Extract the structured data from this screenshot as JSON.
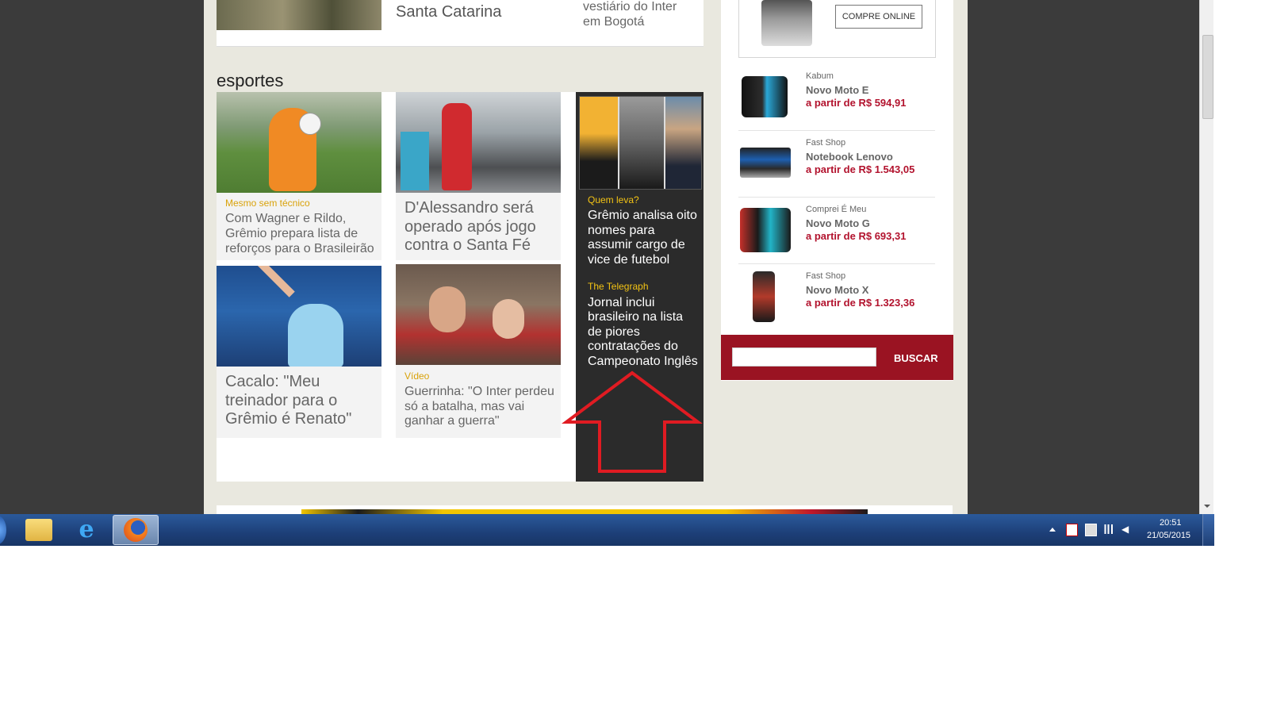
{
  "top_stories": {
    "story_a": "Santa Catarina",
    "story_b_line1": "vestiário do Inter",
    "story_b_line2": "em Bogotá"
  },
  "section": {
    "title": "esportes"
  },
  "sports": {
    "card1": {
      "kicker": "Mesmo sem técnico",
      "headline_line1": "Com Wagner e Rildo,",
      "headline_line2": "Grêmio prepara lista de",
      "headline_line3": "reforços para o Brasileirão"
    },
    "card2": {
      "headline_line1": "D'Alessandro será",
      "headline_line2": "operado após jogo",
      "headline_line3": "contra o Santa Fé"
    },
    "card3": {
      "headline_line1": "Cacalo: \"Meu",
      "headline_line2": "treinador para o",
      "headline_line3": "Grêmio é Renato\""
    },
    "card4": {
      "kicker": "Vídeo",
      "headline_line1": "Guerrinha: \"O Inter perdeu",
      "headline_line2": "só a batalha, mas vai",
      "headline_line3": "ganhar a guerra\""
    }
  },
  "dark_panel": {
    "item1": {
      "kicker": "Quem leva?",
      "line1": "Grêmio analisa oito",
      "line2": "nomes para",
      "line3": "assumir cargo de",
      "line4": "vice de futebol"
    },
    "item2": {
      "kicker": "The Telegraph",
      "line1": "Jornal inclui",
      "line2": "brasileiro na lista",
      "line3": "de piores",
      "line4": "contratações do",
      "line5": "Campeonato Inglês"
    }
  },
  "shopping": {
    "buy_button": "COMPRE ONLINE",
    "items": [
      {
        "store": "Kabum",
        "name": "Novo Moto E",
        "price": "a partir de R$ 594,91"
      },
      {
        "store": "Fast Shop",
        "name": "Notebook Lenovo",
        "price": "a partir de R$ 1.543,05"
      },
      {
        "store": "Comprei É Meu",
        "name": "Novo Moto G",
        "price": "a partir de R$ 693,31"
      },
      {
        "store": "Fast Shop",
        "name": "Novo Moto X",
        "price": "a partir de R$ 1.323,36"
      }
    ],
    "search_placeholder": "",
    "search_button": "BUSCAR"
  },
  "taskbar": {
    "time": "20:51",
    "date": "21/05/2015"
  },
  "colors": {
    "accent": "#b2122d",
    "kicker": "#d9a20a",
    "dark_panel": "#2b2b2b",
    "search_bar": "#9a1322",
    "arrow": "#e01b22"
  }
}
